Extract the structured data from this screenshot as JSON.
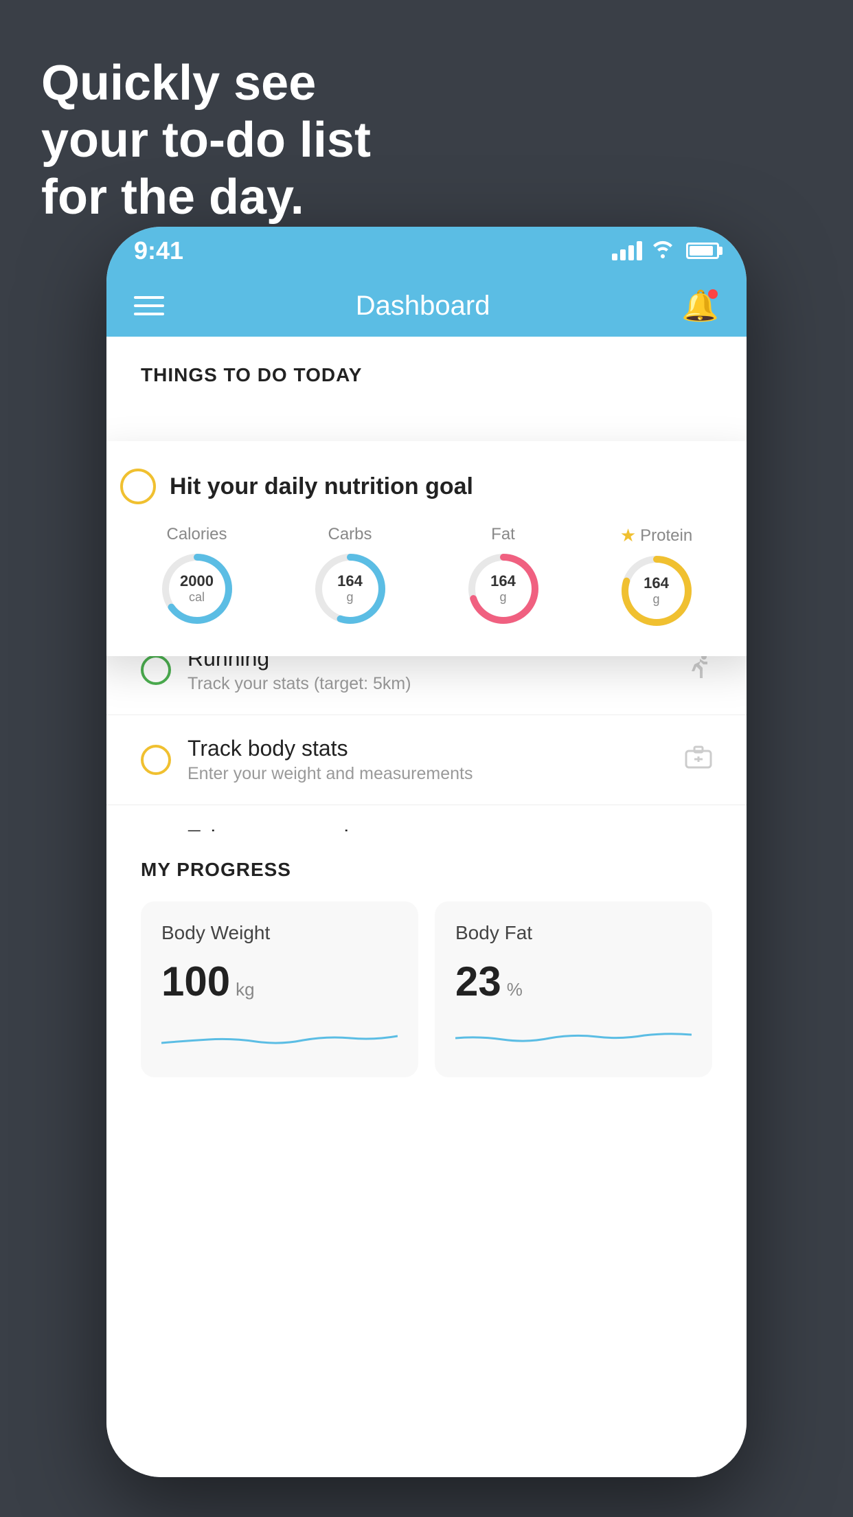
{
  "headline": {
    "line1": "Quickly see",
    "line2": "your to-do list",
    "line3": "for the day."
  },
  "statusBar": {
    "time": "9:41"
  },
  "navBar": {
    "title": "Dashboard"
  },
  "thingsToDo": {
    "sectionTitle": "THINGS TO DO TODAY",
    "nutritionCard": {
      "checkColor": "#f0c030",
      "title": "Hit your daily nutrition goal",
      "items": [
        {
          "label": "Calories",
          "value": "2000",
          "unit": "cal",
          "color": "#5bbde4",
          "percent": 65
        },
        {
          "label": "Carbs",
          "value": "164",
          "unit": "g",
          "color": "#5bbde4",
          "percent": 55
        },
        {
          "label": "Fat",
          "value": "164",
          "unit": "g",
          "color": "#f06080",
          "percent": 70
        },
        {
          "label": "Protein",
          "value": "164",
          "unit": "g",
          "color": "#f0c030",
          "percent": 80,
          "star": true
        }
      ]
    },
    "todoItems": [
      {
        "id": "running",
        "circleColor": "green",
        "title": "Running",
        "subtitle": "Track your stats (target: 5km)",
        "icon": "👟"
      },
      {
        "id": "body-stats",
        "circleColor": "yellow",
        "title": "Track body stats",
        "subtitle": "Enter your weight and measurements",
        "icon": "⚖"
      },
      {
        "id": "progress-photos",
        "circleColor": "yellow",
        "title": "Take progress photos",
        "subtitle": "Add images of your front, back, and side",
        "icon": "🖼"
      }
    ]
  },
  "myProgress": {
    "sectionTitle": "MY PROGRESS",
    "cards": [
      {
        "title": "Body Weight",
        "value": "100",
        "unit": "kg"
      },
      {
        "title": "Body Fat",
        "value": "23",
        "unit": "%"
      }
    ]
  }
}
